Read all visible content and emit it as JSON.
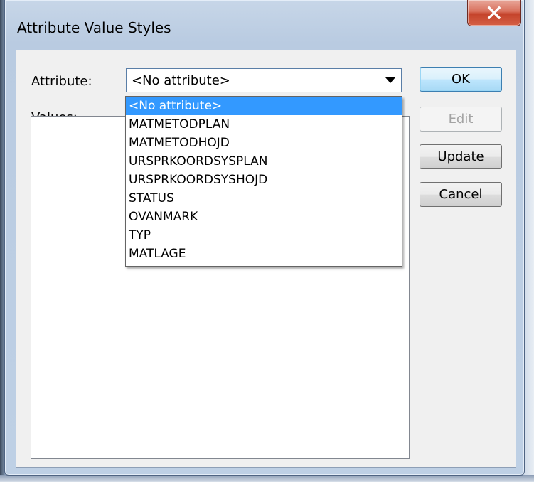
{
  "window": {
    "title": "Attribute Value Styles"
  },
  "attribute": {
    "label": "Attribute:",
    "selected": "<No attribute>",
    "options": [
      "<No attribute>",
      "MATMETODPLAN",
      "MATMETODHOJD",
      "URSPRKOORDSYSPLAN",
      "URSPRKOORDSYSHOJD",
      "STATUS",
      "OVANMARK",
      "TYP",
      "MATLAGE"
    ]
  },
  "values": {
    "label": "Values:"
  },
  "buttons": {
    "ok": "OK",
    "edit": "Edit",
    "update": "Update",
    "cancel": "Cancel"
  },
  "colors": {
    "selection": "#3399ff",
    "close": "#c4432b"
  },
  "icons": {
    "close": "close-icon",
    "dropdown": "chevron-down-icon"
  }
}
